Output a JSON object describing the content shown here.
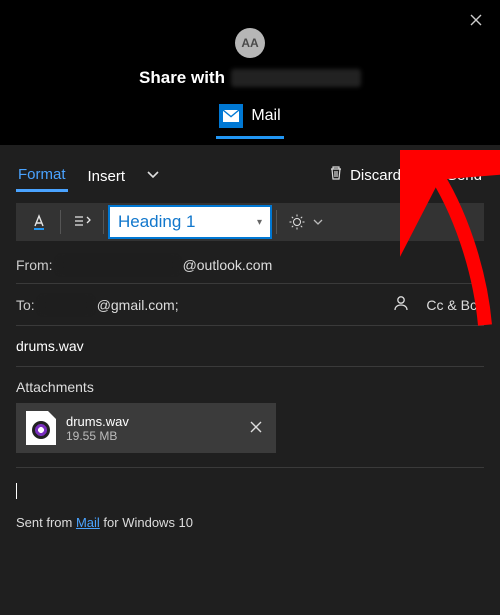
{
  "header": {
    "avatar_initials": "AA",
    "share_label": "Share with",
    "app_tab": "Mail"
  },
  "toolbar": {
    "tabs": {
      "format": "Format",
      "insert": "Insert"
    },
    "discard": "Discard",
    "send": "Send"
  },
  "format_bar": {
    "style_selected": "Heading 1"
  },
  "fields": {
    "from_label": "From:",
    "from_domain": "@outlook.com",
    "to_label": "To:",
    "to_domain": "@gmail.com;",
    "ccbcc": "Cc & Bcc"
  },
  "subject": "drums.wav",
  "attachments": {
    "label": "Attachments",
    "items": [
      {
        "name": "drums.wav",
        "size": "19.55 MB"
      }
    ]
  },
  "signature": {
    "prefix": "Sent from ",
    "link": "Mail",
    "suffix": " for Windows 10"
  }
}
